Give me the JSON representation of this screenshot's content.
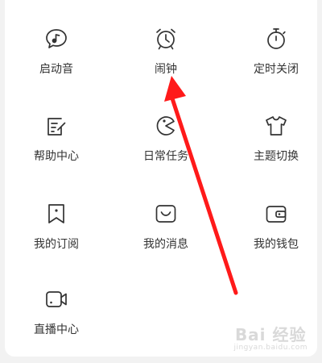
{
  "menu": {
    "items": [
      {
        "label": "启动音",
        "icon": "music-note-bubble-icon"
      },
      {
        "label": "闹钟",
        "icon": "alarm-clock-icon"
      },
      {
        "label": "定时关闭",
        "icon": "stopwatch-icon"
      },
      {
        "label": "帮助中心",
        "icon": "edit-note-icon"
      },
      {
        "label": "日常任务",
        "icon": "pacman-icon"
      },
      {
        "label": "主题切换",
        "icon": "tshirt-icon"
      },
      {
        "label": "我的订阅",
        "icon": "bookmark-icon"
      },
      {
        "label": "我的消息",
        "icon": "message-icon"
      },
      {
        "label": "我的钱包",
        "icon": "wallet-icon"
      },
      {
        "label": "直播中心",
        "icon": "video-camera-icon"
      }
    ]
  },
  "annotation": {
    "arrow_color": "#ff1a1a"
  },
  "watermark": {
    "logo": "Bai 经验",
    "url": "jingyan.baidu.com"
  }
}
